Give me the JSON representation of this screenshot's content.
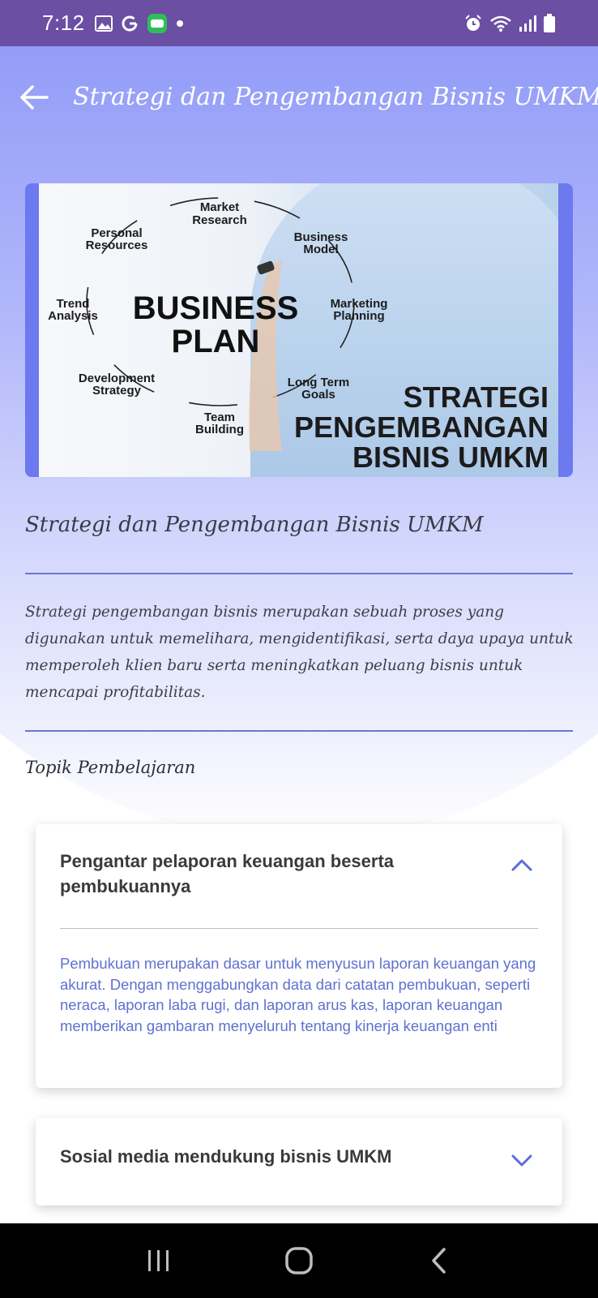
{
  "status_bar": {
    "time": "7:12",
    "left_icons": [
      "gallery-icon",
      "google-icon",
      "app-badge-icon",
      "dot-icon"
    ],
    "right_icons": [
      "alarm-icon",
      "wifi-icon",
      "signal-icon",
      "battery-icon"
    ]
  },
  "app_bar": {
    "title": "Strategi dan Pengembangan Bisnis UMKM",
    "back_icon": "arrow-left-icon"
  },
  "banner": {
    "center_line1": "BUSINESS",
    "center_line2": "PLAN",
    "nodes": {
      "market_research": [
        "Market",
        "Research"
      ],
      "business_model": [
        "Business",
        "Model"
      ],
      "marketing_planning": [
        "Marketing",
        "Planning"
      ],
      "long_term_goals": [
        "Long Term",
        "Goals"
      ],
      "team_building": [
        "Team",
        "Building"
      ],
      "development_strategy": [
        "Development",
        "Strategy"
      ],
      "trend_analysis": [
        "Trend",
        "Analysis"
      ],
      "personal_resources": [
        "Personal",
        "Resources"
      ]
    },
    "caption_lines": [
      "STRATEGI",
      "PENGEMBANGAN",
      "BISNIS UMKM"
    ]
  },
  "content": {
    "title": "Strategi dan Pengembangan Bisnis UMKM",
    "description": "Strategi pengembangan bisnis merupakan sebuah proses yang digunakan untuk memelihara, mengidentifikasi, serta daya upaya untuk memperoleh klien baru serta meningkatkan peluang bisnis untuk mencapai profitabilitas.",
    "topics_heading": "Topik Pembelajaran"
  },
  "topics": [
    {
      "title": "Pengantar pelaporan keuangan beserta pembukuannya",
      "expanded": true,
      "body": "Pembukuan merupakan dasar untuk menyusun laporan keuangan yang akurat. Dengan menggabungkan data dari catatan pembukuan, seperti neraca, laporan laba rugi, dan laporan arus kas, laporan keuangan memberikan gambaran menyeluruh tentang kinerja keuangan enti"
    },
    {
      "title": "Sosial media mendukung bisnis UMKM",
      "expanded": false
    }
  ],
  "colors": {
    "status_bar": "#6b4fa3",
    "accent": "#6677d6",
    "hero_gradient_top": "#7b87f5",
    "body_text_accent": "#5f71d0"
  },
  "nav_bar": {
    "icons": [
      "recent-apps-icon",
      "home-icon",
      "back-icon"
    ]
  }
}
